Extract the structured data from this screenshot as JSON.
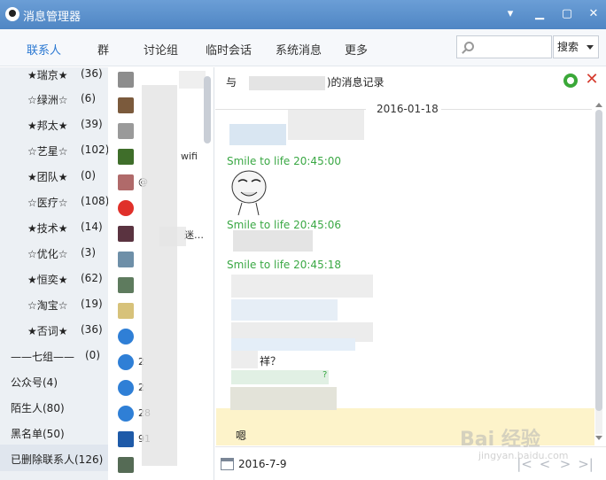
{
  "window": {
    "title": "消息管理器",
    "min": "▾",
    "minimize": "▁",
    "maximize": "▢",
    "close": "✕"
  },
  "tabs": [
    {
      "label": "联系人",
      "active": true
    },
    {
      "label": "群"
    },
    {
      "label": "讨论组"
    },
    {
      "label": "临时会话"
    },
    {
      "label": "系统消息"
    },
    {
      "label": "更多"
    }
  ],
  "search": {
    "value": "",
    "button_label": "搜索"
  },
  "groups": [
    {
      "name": "★瑞京★",
      "count": "(36)"
    },
    {
      "name": "☆绿洲☆",
      "count": "(6)"
    },
    {
      "name": "★邦太★",
      "count": "(39)"
    },
    {
      "name": "☆艺星☆",
      "count": "(102)"
    },
    {
      "name": "★团队★",
      "count": "(0)"
    },
    {
      "name": "☆医疗☆",
      "count": "(108)"
    },
    {
      "name": "★技术★",
      "count": "(14)"
    },
    {
      "name": "☆优化☆",
      "count": "(3)"
    },
    {
      "name": "★恒奕★",
      "count": "(62)"
    },
    {
      "name": "☆淘宝☆",
      "count": "(19)"
    },
    {
      "name": "★否词★",
      "count": "(36)"
    },
    {
      "name": "——七组——",
      "count": "(0)"
    },
    {
      "name": "公众号(4)",
      "count": ""
    },
    {
      "name": "陌生人(80)",
      "count": ""
    },
    {
      "name": "黑名单(50)",
      "count": ""
    },
    {
      "name": "已删除联系人(126)",
      "count": "",
      "selected": true
    }
  ],
  "contacts": [
    {
      "name": "",
      "avatar": "#8d8d8d"
    },
    {
      "name": "",
      "avatar": "#7b5a3c"
    },
    {
      "name": "",
      "avatar": "#9a9a9a"
    },
    {
      "name": "wifi",
      "avatar": "#3f6e2a"
    },
    {
      "name": "@",
      "avatar": "#b06a6a"
    },
    {
      "name": "",
      "avatar": "#e0302a"
    },
    {
      "name": "迷…",
      "avatar": "#5a3340"
    },
    {
      "name": "",
      "avatar": "#6e8fa8"
    },
    {
      "name": "",
      "avatar": "#5e7b5e"
    },
    {
      "name": "",
      "avatar": "#d7c27a"
    },
    {
      "name": "",
      "avatar": "#2f7fd6"
    },
    {
      "name": "2",
      "avatar": "#2f7fd6"
    },
    {
      "name": "2",
      "avatar": "#2f7fd6"
    },
    {
      "name": "28",
      "avatar": "#2f7fd6"
    },
    {
      "name": "91",
      "avatar": "#1e5aa8"
    },
    {
      "name": "",
      "avatar": "#556b55"
    }
  ],
  "conversation": {
    "prefix": "与",
    "suffix": ")的消息记录",
    "date_separator": "2016-01-18",
    "messages": [
      {
        "meta": "",
        "text": ""
      },
      {
        "meta": "Smile to life 20:45:00",
        "text": ""
      },
      {
        "meta": "Smile to life 20:45:06",
        "text": ""
      },
      {
        "meta": "Smile to life 20:45:18",
        "text": ""
      }
    ],
    "partial_text": "祥？",
    "partial_text_2": "?",
    "last_message": "嗯"
  },
  "footer": {
    "date": "2016-7-9"
  },
  "watermark": {
    "brand": "Bai 经验",
    "url": "jingyan.baidu.com"
  }
}
